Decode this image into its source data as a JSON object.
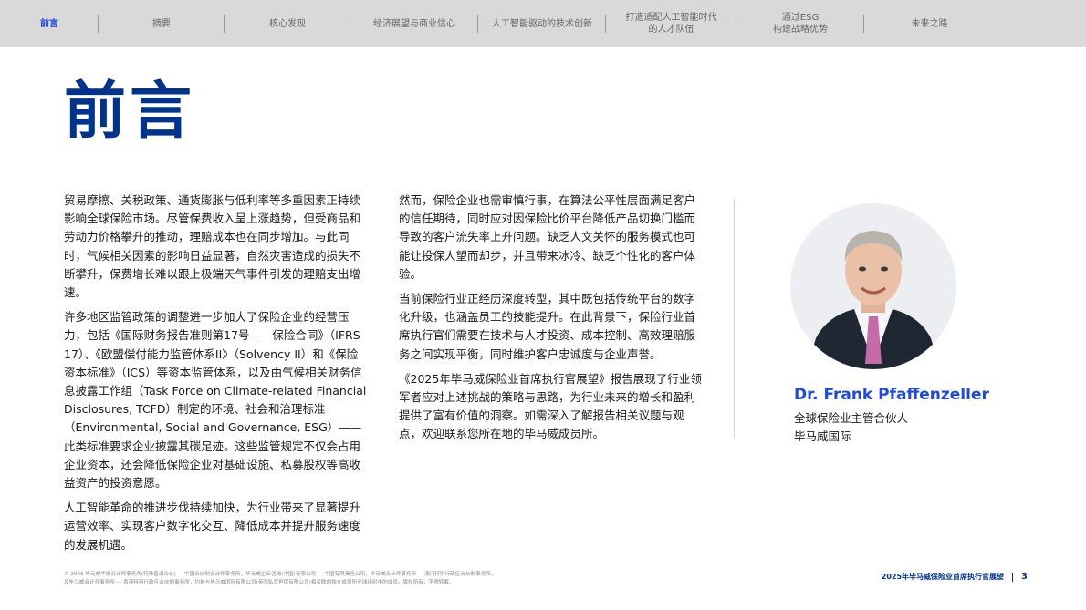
{
  "nav": {
    "items": [
      {
        "label": "前言",
        "active": true
      },
      {
        "label": "摘要",
        "active": false
      },
      {
        "label": "核心发现",
        "active": false
      },
      {
        "label": "经济展望与商业信心",
        "active": false
      },
      {
        "label": "人工智能驱动的技术创新",
        "active": false
      },
      {
        "label": "打造适配人工智能时代\n的人才队伍",
        "active": false
      },
      {
        "label": "通过ESG\n构建战略优势",
        "active": false
      },
      {
        "label": "未来之路",
        "active": false
      }
    ]
  },
  "page_title": "前言",
  "body": {
    "column1": [
      "贸易摩擦、关税政策、通货膨胀与低利率等多重因素正持续影响全球保险市场。尽管保费收入呈上涨趋势，但受商品和劳动力价格攀升的推动，理赔成本也在同步增加。与此同时，气候相关因素的影响日益显著，自然灾害造成的损失不断攀升，保费增长难以跟上极端天气事件引发的理赔支出增速。",
      "许多地区监管政策的调整进一步加大了保险企业的经营压力，包括《国际财务报告准则第17号——保险合同》（IFRS 17）、《欧盟偿付能力监管体系II》（Solvency II）和《保险资本标准》（ICS）等资本监管体系，以及由气候相关财务信息披露工作组（Task Force on Climate-related Financial Disclosures, TCFD）制定的环境、社会和治理标准（Environmental, Social and Governance, ESG）——此类标准要求企业披露其碳足迹。这些监管规定不仅会占用企业资本，还会降低保险企业对基础设施、私募股权等高收益资产的投资意愿。",
      "人工智能革命的推进步伐持续加快，为行业带来了显著提升运营效率、实现客户数字化交互、降低成本并提升服务速度的发展机遇。"
    ],
    "column2": [
      "然而，保险企业也需审慎行事，在算法公平性层面满足客户的信任期待，同时应对因保险比价平台降低产品切换门槛而导致的客户流失率上升问题。缺乏人文关怀的服务模式也可能让投保人望而却步，并且带来冰冷、缺乏个性化的客户体验。",
      "当前保险行业正经历深度转型，其中既包括传统平台的数字化升级，也涵盖员工的技能提升。在此背景下，保险行业首席执行官们需要在技术与人才投资、成本控制、高效理赔服务之间实现平衡，同时维护客户忠诚度与企业声誉。",
      "《2025年毕马威保险业首席执行官展望》报告展现了行业领军者应对上述挑战的策略与思路，为行业未来的增长和盈利提供了富有价值的洞察。如需深入了解报告相关议题与观点，欢迎联系您所在地的毕马威成员所。"
    ]
  },
  "person": {
    "name": "Dr. Frank Pfaffenzeller",
    "role": "全球保险业主管合伙人",
    "org": "毕马威国际"
  },
  "footer": {
    "legal_line1": "© 2026 毕马威华振会计师事务所(特殊普通合伙) — 中国合伙制会计师事务所，毕马威企业咨询(中国)有限公司 — 中国有限责任公司，毕马威会计师事务所 — 澳门特别行政区合伙制事务所，",
    "legal_line2": "及毕马威会计师事务所 — 香港特别行政区合伙制事务所，均是与毕马威国际有限公司(英国私营担保有限公司)相关联的独立成员所全球组织中的成员。版权所有，不得转载。",
    "report_title": "2025年毕马威保险业首席执行官展望",
    "page_number": "3"
  },
  "colors": {
    "brand_blue": "#00338d",
    "accent_blue": "#1e49e2",
    "nav_bg": "#d9d9d9"
  }
}
